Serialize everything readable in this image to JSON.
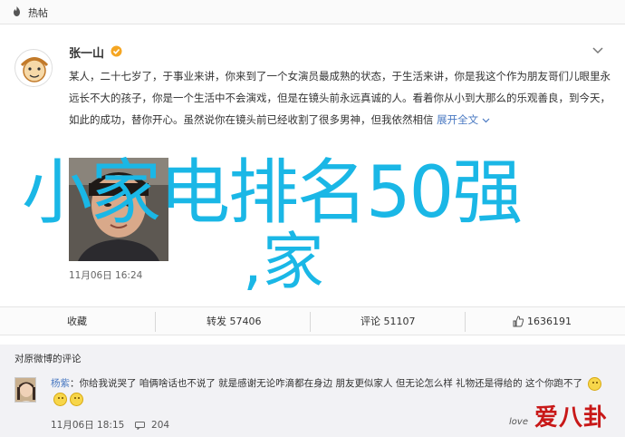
{
  "topbar": {
    "title": "热帖"
  },
  "post": {
    "username": "张一山",
    "text_main": "某人，二十七岁了，于事业来讲，你来到了一个女演员最成熟的状态，于生活来讲，你是我这个作为朋友哥们儿眼里永远长不大的孩子，你是一个生活中不会演戏，但是在镜头前永远真诚的人。看着你从小到大那么的乐观善良，到今天，如此的成功，替你开心。虽然说你在镜头前已经收割了很多男神，但我依然相信",
    "fold_label": "展开全文",
    "time": "11月06日 16:24"
  },
  "overlay": {
    "line1": "小家电排名50强",
    "line2": ",家"
  },
  "actions": {
    "favorite": "收藏",
    "repost": "转发 57406",
    "comment": "评论 51107",
    "like": "1636191"
  },
  "comments": {
    "header": "对原微博的评论",
    "author": "杨紫",
    "text": "：你给我说哭了 咱俩啥话也不说了 就是感谢无论咋滴都在身边 朋友更似家人 但无论怎么样 礼物还是得给的 这个你跑不了",
    "time": "11月06日 18:15",
    "reply_count": "204"
  },
  "watermark": {
    "main": "爱八卦",
    "small": "love"
  },
  "colors": {
    "overlay": "#1ab7e6",
    "link": "#4a79c2",
    "watermark": "#c81818"
  },
  "icons": {
    "hot": "flame-icon",
    "verified": "verified-badge-icon",
    "more": "chevron-down-icon",
    "like": "thumbs-up-icon",
    "reply": "reply-icon"
  }
}
